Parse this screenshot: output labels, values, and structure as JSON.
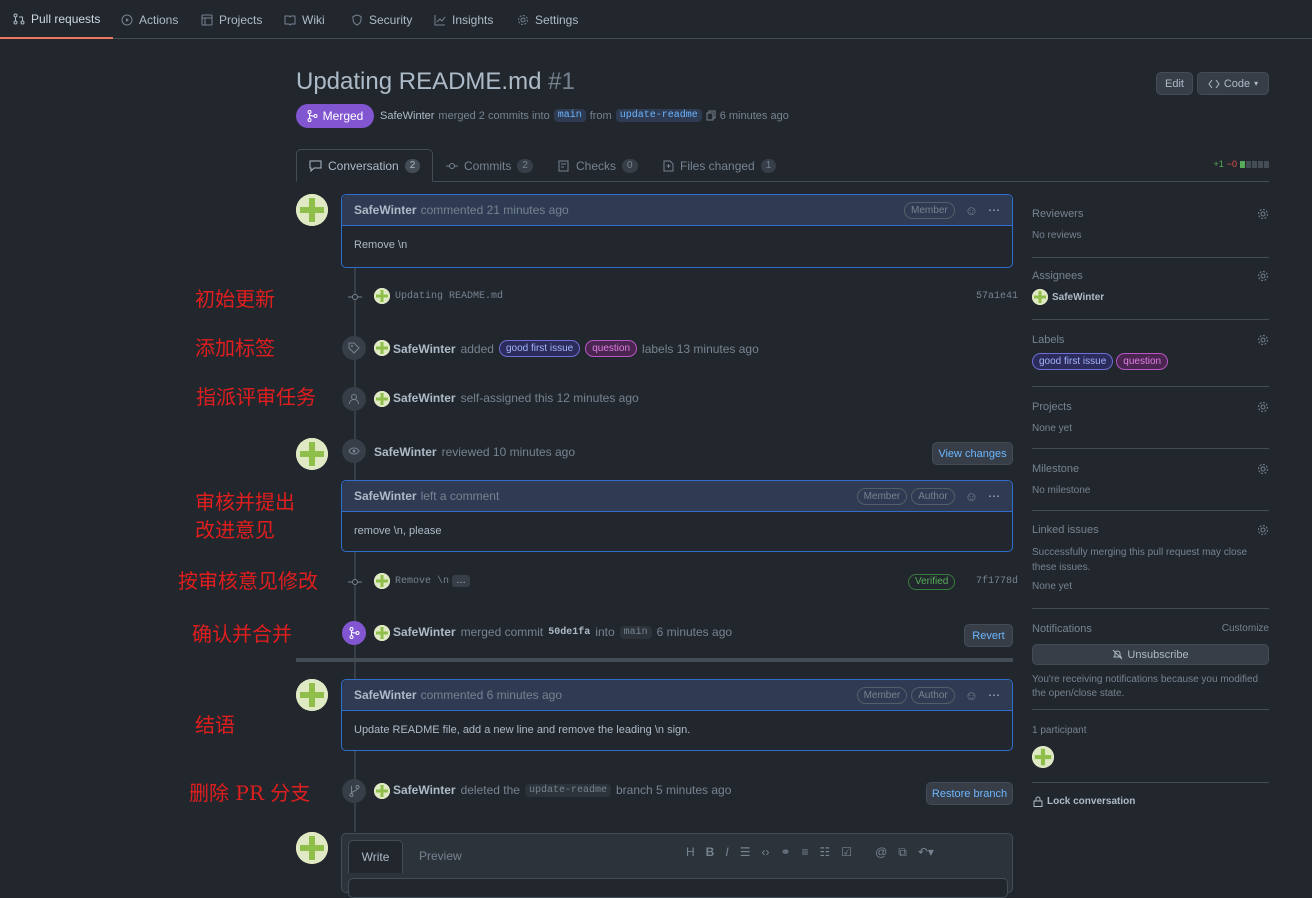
{
  "nav": {
    "items": [
      {
        "label": "Pull requests",
        "icon": "pull-request-icon"
      },
      {
        "label": "Actions",
        "icon": "play-icon"
      },
      {
        "label": "Projects",
        "icon": "table-icon"
      },
      {
        "label": "Wiki",
        "icon": "book-icon"
      },
      {
        "label": "Security",
        "icon": "shield-icon"
      },
      {
        "label": "Insights",
        "icon": "graph-icon"
      },
      {
        "label": "Settings",
        "icon": "gear-icon"
      }
    ]
  },
  "pr": {
    "title": "Updating README.md",
    "number": "#1",
    "status": "Merged",
    "author": "SafeWinter",
    "merge_text": "merged 2 commits into",
    "base": "main",
    "from_word": "from",
    "head": "update-readme",
    "time": "6 minutes ago",
    "edit_label": "Edit",
    "code_label": "Code"
  },
  "tabs": [
    {
      "label": "Conversation",
      "count": "2"
    },
    {
      "label": "Commits",
      "count": "2"
    },
    {
      "label": "Checks",
      "count": "0"
    },
    {
      "label": "Files changed",
      "count": "1"
    }
  ],
  "diffstat": {
    "add": "+1",
    "del": "−0"
  },
  "timeline": {
    "c1": {
      "author": "SafeWinter",
      "action": "commented 21 minutes ago",
      "role": "Member",
      "body": "Remove \\n"
    },
    "commit1": {
      "message": "Updating README.md",
      "sha": "57a1e41"
    },
    "labels_event": {
      "author": "SafeWinter",
      "added": "added",
      "label1": "good first issue",
      "label2": "question",
      "suffix": "labels 13 minutes ago"
    },
    "assign_event": {
      "author": "SafeWinter",
      "text": "self-assigned this 12 minutes ago"
    },
    "review_event": {
      "author": "SafeWinter",
      "text": "reviewed 10 minutes ago",
      "button": "View changes"
    },
    "review_comment": {
      "author": "SafeWinter",
      "action": "left a comment",
      "role1": "Member",
      "role2": "Author",
      "body": "remove \\n, please"
    },
    "commit2": {
      "message": "Remove \\n",
      "ellipsis": "…",
      "verified": "Verified",
      "sha": "7f1778d"
    },
    "merge_event": {
      "author": "SafeWinter",
      "pre": "merged commit",
      "sha": "50de1fa",
      "into": "into",
      "base": "main",
      "time": "6 minutes ago",
      "button": "Revert"
    },
    "c2": {
      "author": "SafeWinter",
      "action": "commented 6 minutes ago",
      "role1": "Member",
      "role2": "Author",
      "body": "Update README file, add a new line and remove the leading \\n sign."
    },
    "delete_event": {
      "author": "SafeWinter",
      "pre": "deleted the",
      "branch": "update-readme",
      "post": "branch 5 minutes ago",
      "button": "Restore branch"
    }
  },
  "editor": {
    "write": "Write",
    "preview": "Preview"
  },
  "annotations": [
    "初始更新",
    "添加标签",
    "指派评审任务",
    "审核并提出",
    "改进意见",
    "按审核意见修改",
    "确认并合并",
    "结语",
    "删除 PR 分支"
  ],
  "sidebar": {
    "reviewers": {
      "title": "Reviewers",
      "value": "No reviews"
    },
    "assignees": {
      "title": "Assignees",
      "value": "SafeWinter"
    },
    "labels": {
      "title": "Labels",
      "label1": "good first issue",
      "label2": "question"
    },
    "projects": {
      "title": "Projects",
      "value": "None yet"
    },
    "milestone": {
      "title": "Milestone",
      "value": "No milestone"
    },
    "linked": {
      "title": "Linked issues",
      "desc": "Successfully merging this pull request may close these issues.",
      "value": "None yet"
    },
    "notifications": {
      "title": "Notifications",
      "customize": "Customize",
      "button": "Unsubscribe",
      "desc": "You're receiving notifications because you modified the open/close state."
    },
    "participants": {
      "title": "1 participant"
    },
    "lock": "Lock conversation"
  }
}
